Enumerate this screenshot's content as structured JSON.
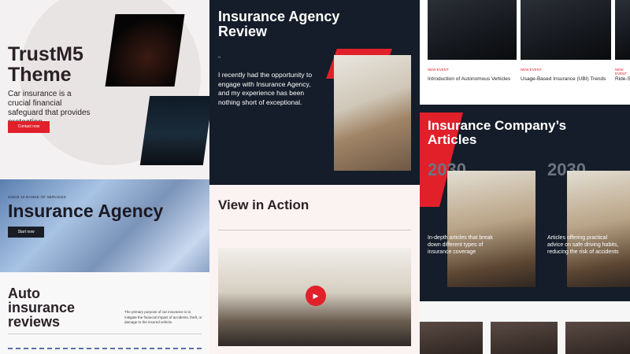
{
  "hero": {
    "title": "TrustM5 Theme",
    "tagline": "Car insurance is a crucial financial safeguard that provides protection.",
    "cta": "Contact now"
  },
  "agency": {
    "eyebrow": "SINCE 10 RANGE OF SERVICES",
    "title": "Insurance Agency",
    "cta": "Start now"
  },
  "reviews": {
    "title": "Auto insurance reviews",
    "desc": "The primary purpose of car insurance is to mitigate the financial impact of accidents, theft, or damage to the insured vehicle."
  },
  "review": {
    "title": "Insurance Agency Review",
    "quote_mark": "“",
    "text": "I recently had the opportunity to engage with Insurance Agency, and my experience has been nothing short of exceptional."
  },
  "action": {
    "title": "View in Action",
    "play": "▶"
  },
  "events": [
    {
      "label": "NEW EVENT",
      "title": "Introduction of Autonomous Vehicles"
    },
    {
      "label": "NEW EVENT",
      "title": "Usage-Based Insurance (UBI) Trends"
    },
    {
      "label": "NEW EVENT",
      "title": "Ride-S"
    }
  ],
  "articles": {
    "title": "Insurance Company’s Articles",
    "items": [
      {
        "year": "2030",
        "text": "In-depth articles that break down different types of insurance coverage"
      },
      {
        "year": "2030",
        "text": "Articles offering practical advice on safe driving habits, reducing the risk of accidents"
      }
    ]
  },
  "icons": {
    "play": "play-icon",
    "quote": "quote-icon"
  },
  "colors": {
    "accent": "#e1202a",
    "dark": "#141d29"
  }
}
